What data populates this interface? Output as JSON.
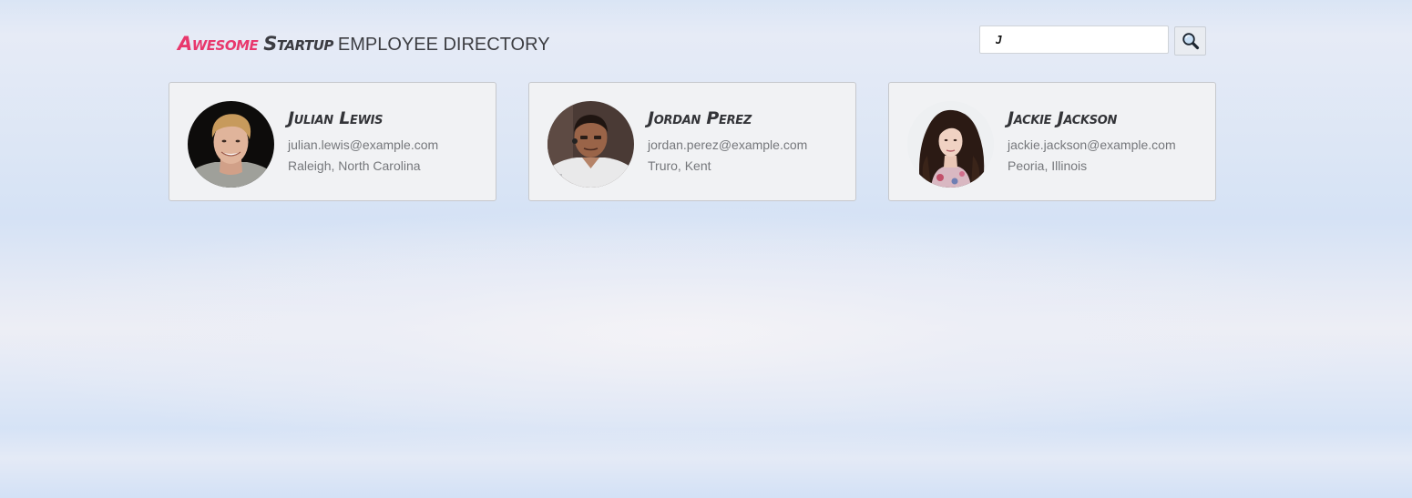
{
  "header": {
    "brand_first": "Awesome",
    "brand_second": "Startup",
    "title_rest": "EMPLOYEE DIRECTORY"
  },
  "search": {
    "value": "J",
    "placeholder": "",
    "button_icon": "magnifier-icon"
  },
  "employees": [
    {
      "name": "Julian Lewis",
      "email": "julian.lewis@example.com",
      "location": "Raleigh, North Carolina"
    },
    {
      "name": "Jordan Perez",
      "email": "jordan.perez@example.com",
      "location": "Truro, Kent"
    },
    {
      "name": "Jackie Jackson",
      "email": "jackie.jackson@example.com",
      "location": "Peoria, Illinois"
    }
  ],
  "colors": {
    "brand_accent": "#e8386d",
    "text_dark": "#333438",
    "text_muted": "#75777b",
    "card_background": "#f1f2f4"
  }
}
